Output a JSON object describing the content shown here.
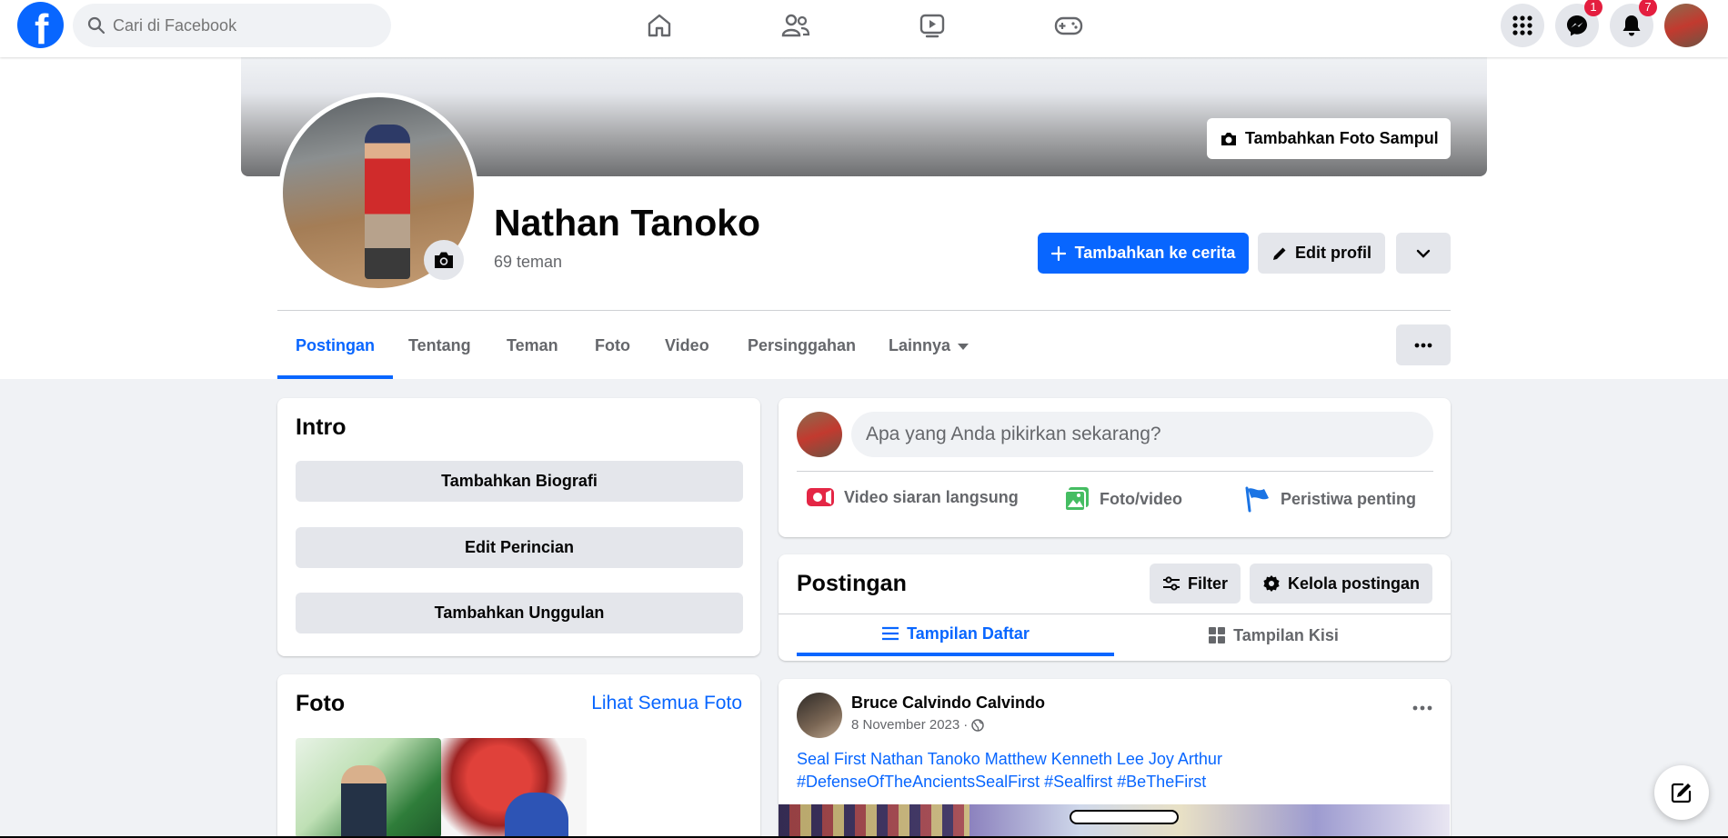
{
  "topbar": {
    "search_placeholder": "Cari di Facebook",
    "messenger_badge": "1",
    "notifications_badge": "7"
  },
  "profile": {
    "cover_button": "Tambahkan Foto Sampul",
    "name": "Nathan Tanoko",
    "friends": "69 teman",
    "add_story": "Tambahkan ke cerita",
    "edit_profile": "Edit profil"
  },
  "tabs": [
    "Postingan",
    "Tentang",
    "Teman",
    "Foto",
    "Video",
    "Persinggahan",
    "Lainnya"
  ],
  "intro": {
    "title": "Intro",
    "buttons": [
      "Tambahkan Biografi",
      "Edit Perincian",
      "Tambahkan Unggulan"
    ]
  },
  "photos": {
    "title": "Foto",
    "see_all": "Lihat Semua Foto"
  },
  "composer": {
    "placeholder": "Apa yang Anda pikirkan sekarang?",
    "actions": [
      "Video siaran langsung",
      "Foto/video",
      "Peristiwa penting"
    ]
  },
  "posts": {
    "title": "Postingan",
    "filter": "Filter",
    "manage": "Kelola postingan",
    "list_view": "Tampilan Daftar",
    "grid_view": "Tampilan Kisi"
  },
  "post": {
    "author": "Bruce Calvindo Calvindo",
    "date": "8 November 2023",
    "separator": "·",
    "text_line1": "Seal First Nathan Tanoko Matthew Kenneth Lee Joy Arthur",
    "text_line2": "#DefenseOfTheAncientsSealFirst #Sealfirst #BeTheFirst"
  },
  "colors": {
    "brand": "#0866ff",
    "badge": "#e41e3f"
  }
}
